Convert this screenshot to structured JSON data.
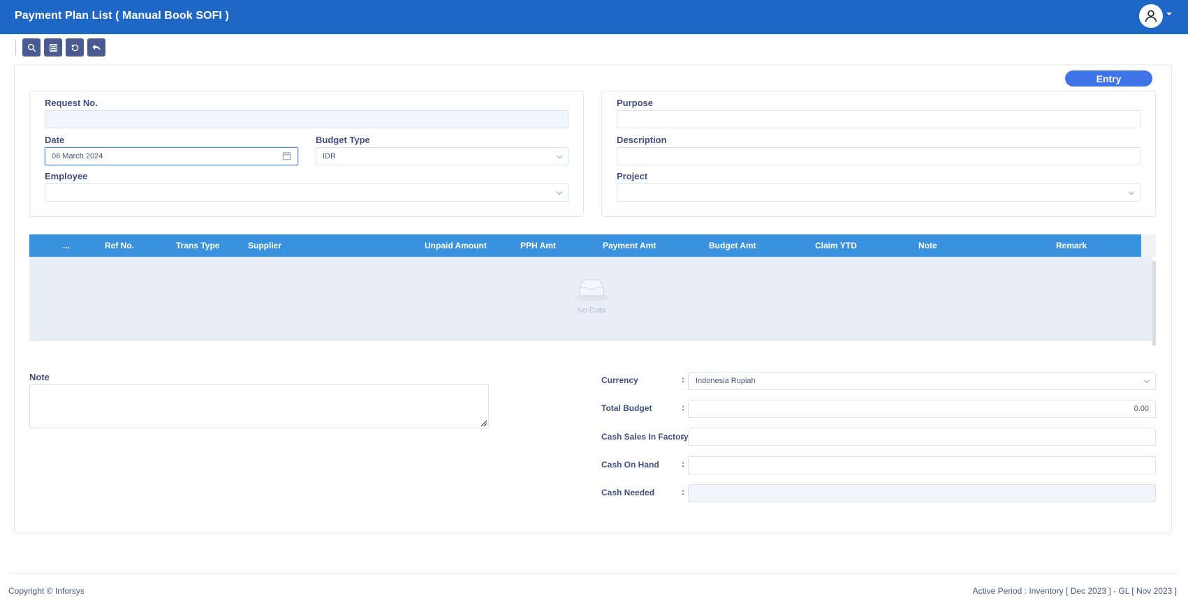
{
  "header": {
    "title": "Payment Plan List ( Manual Book SOFI )"
  },
  "toolbar": {
    "buttons": [
      "search-icon",
      "save-icon",
      "refresh-icon",
      "undo-icon"
    ]
  },
  "status_badge": "Entry",
  "form": {
    "request_no": {
      "label": "Request No.",
      "value": ""
    },
    "date": {
      "label": "Date",
      "value": "06 March 2024"
    },
    "budget_type": {
      "label": "Budget Type",
      "value": "IDR"
    },
    "employee": {
      "label": "Employee",
      "value": ""
    },
    "purpose": {
      "label": "Purpose",
      "value": ""
    },
    "description": {
      "label": "Description",
      "value": ""
    },
    "project": {
      "label": "Project",
      "value": ""
    }
  },
  "grid": {
    "columns": [
      "...",
      "Ref No.",
      "Trans Type",
      "Supplier",
      "Unpaid Amount",
      "PPH Amt",
      "Payment Amt",
      "Budget Amt",
      "Claim YTD",
      "Note",
      "Remark"
    ],
    "rows": [],
    "empty_text": "No Data"
  },
  "note": {
    "label": "Note",
    "value": ""
  },
  "summary": {
    "currency": {
      "label": "Currency",
      "value": "Indonesia Rupiah"
    },
    "total_budget": {
      "label": "Total Budget",
      "value": "0.00"
    },
    "cash_sales_in_factory": {
      "label": "Cash Sales In Factory",
      "value": ""
    },
    "cash_on_hand": {
      "label": "Cash On Hand",
      "value": ""
    },
    "cash_needed": {
      "label": "Cash Needed",
      "value": ""
    },
    "colon": ":"
  },
  "footer": {
    "copyright": "Copyright © Inforsys",
    "active_period": "Active Period  :  Inventory [ Dec 2023 ]  -  GL [ Nov 2023 ]"
  },
  "colors": {
    "header_bg": "#1f67c5",
    "grid_header_bg": "#3a92df",
    "badge_bg": "#3f74e8",
    "toolbar_button_bg": "#4a5b93"
  }
}
